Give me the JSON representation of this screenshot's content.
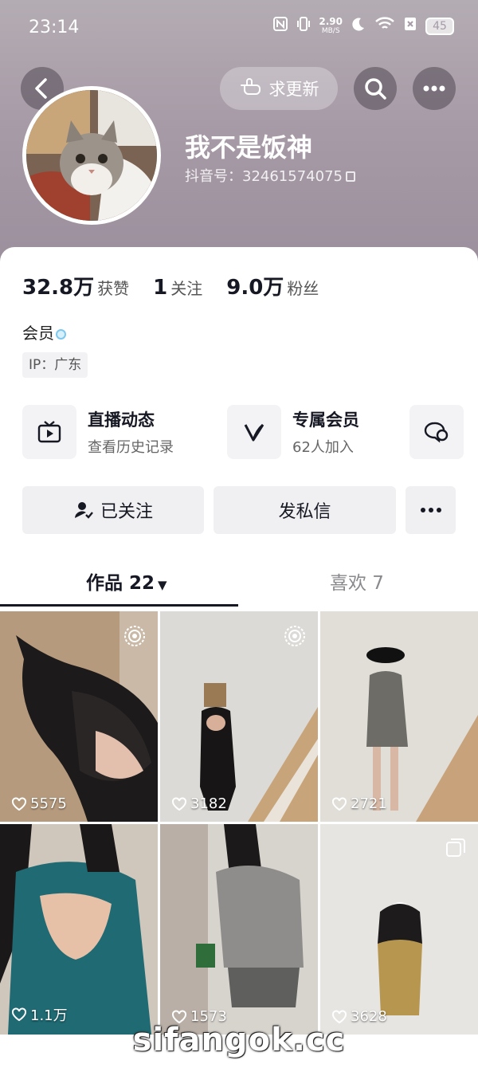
{
  "status_bar": {
    "time": "23:14",
    "speed_value": "2.90",
    "speed_unit": "MB/S",
    "battery": "45"
  },
  "header": {
    "update_label": "求更新"
  },
  "profile": {
    "nickname": "我不是饭神",
    "douyin_id": "抖音号：32461574075"
  },
  "stats": [
    {
      "value": "32.8万",
      "label": "获赞"
    },
    {
      "value": "1",
      "label": "关注"
    },
    {
      "value": "9.0万",
      "label": "粉丝"
    }
  ],
  "member_label": "会员",
  "ip_location": "IP：广东",
  "features": [
    {
      "title": "直播动态",
      "subtitle": "查看历史记录",
      "icon": "tv-icon"
    },
    {
      "title": "专属会员",
      "subtitle": "62人加入",
      "icon": "v-icon"
    },
    {
      "title": "",
      "subtitle": "",
      "icon": "chat-icon"
    }
  ],
  "actions": {
    "follow_label": "已关注",
    "message_label": "发私信"
  },
  "tabs": [
    {
      "label": "作品 22",
      "active": true
    },
    {
      "label": "喜欢 7",
      "active": false
    }
  ],
  "posts": [
    {
      "likes": "5575",
      "badge": "live-icon"
    },
    {
      "likes": "3182",
      "badge": "live-icon"
    },
    {
      "likes": "2721",
      "badge": ""
    },
    {
      "likes": "1.1万",
      "badge": ""
    },
    {
      "likes": "1573",
      "badge": ""
    },
    {
      "likes": "3628",
      "badge": "multi-image-icon"
    }
  ],
  "watermark": "sifangok.cc",
  "colors": {
    "header_bg": "#a79ba7",
    "text_primary": "#161823",
    "button_bg": "#f0f0f2"
  }
}
